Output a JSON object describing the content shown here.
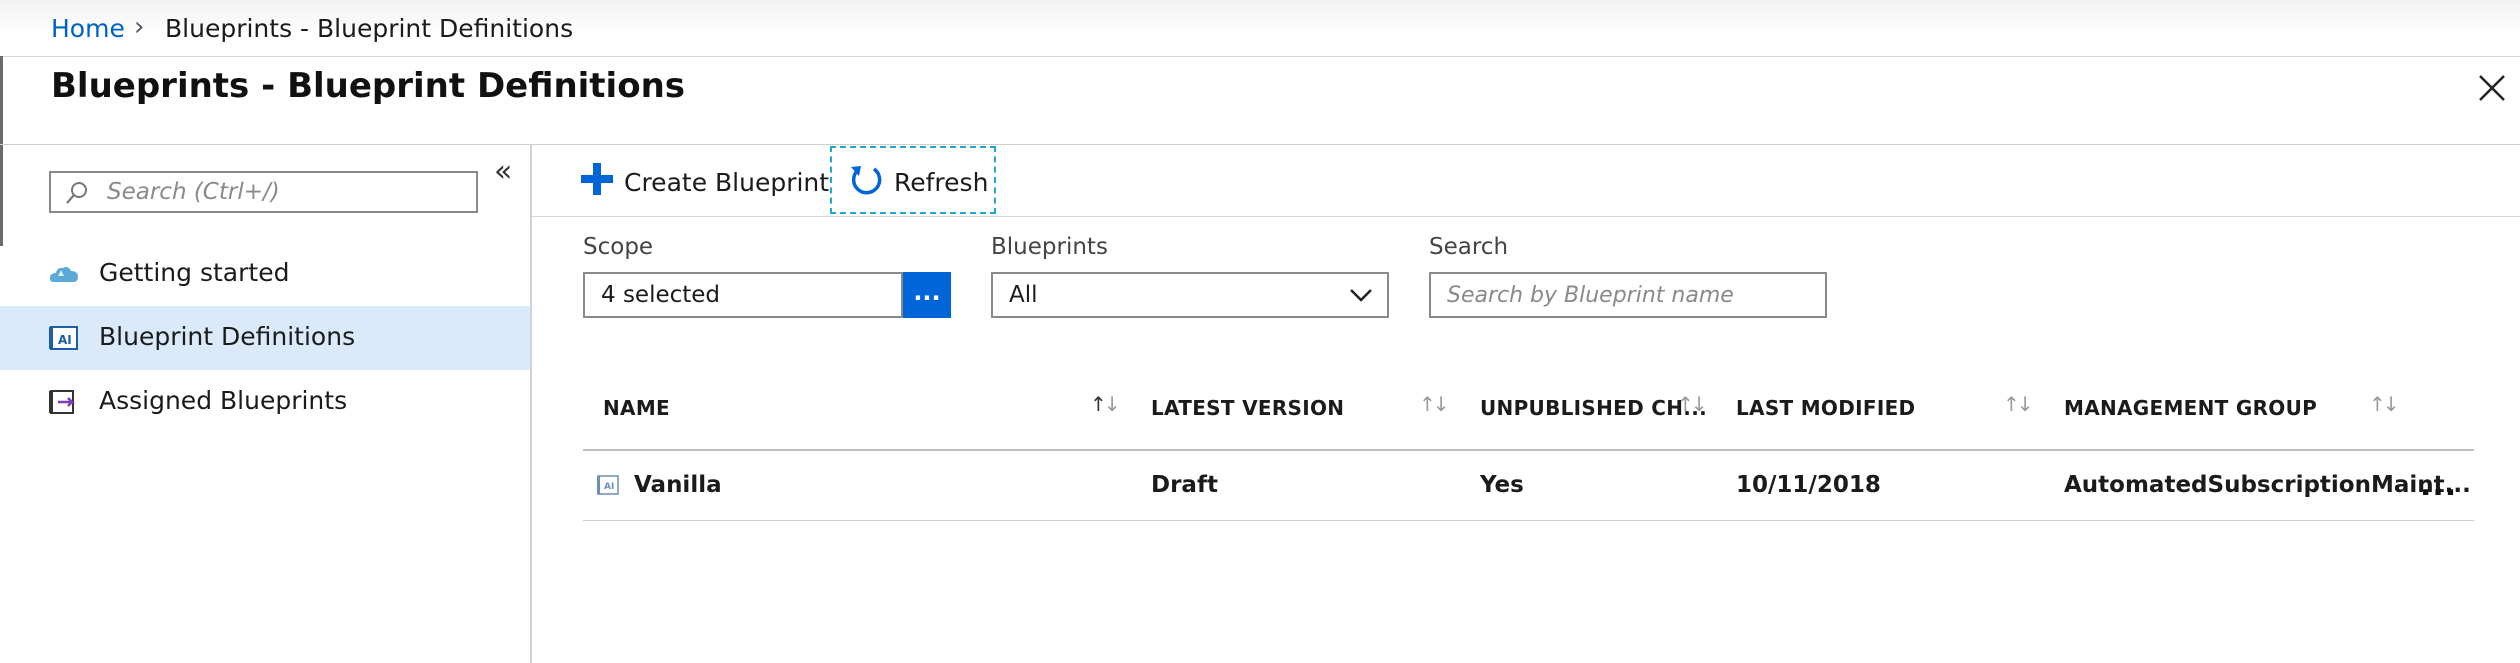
{
  "breadcrumb": {
    "home": "Home",
    "separator": ">",
    "current": "Blueprints - Blueprint Definitions"
  },
  "page": {
    "title": "Blueprints - Blueprint Definitions",
    "close_icon": "close-icon"
  },
  "sidebar": {
    "search_placeholder": "Search (Ctrl+/)",
    "collapse_glyph": "«",
    "items": [
      {
        "label": "Getting started",
        "icon": "cloud-icon",
        "selected": false
      },
      {
        "label": "Blueprint Definitions",
        "icon": "blueprint-definition-icon",
        "selected": true
      },
      {
        "label": "Assigned Blueprints",
        "icon": "assigned-blueprint-icon",
        "selected": false
      }
    ]
  },
  "toolbar": {
    "create_label": "Create Blueprint",
    "refresh_label": "Refresh"
  },
  "filters": {
    "scope_label": "Scope",
    "scope_value": "4 selected",
    "scope_button": "...",
    "blueprints_label": "Blueprints",
    "blueprints_value": "All",
    "search_label": "Search",
    "search_placeholder": "Search by Blueprint name"
  },
  "table": {
    "columns": [
      "NAME",
      "LATEST VERSION",
      "UNPUBLISHED CH...",
      "LAST MODIFIED",
      "MANAGEMENT GROUP"
    ],
    "rows": [
      {
        "name": "Vanilla",
        "latest_version": "Draft",
        "unpublished_changes": "Yes",
        "last_modified": "10/11/2018",
        "management_group": "AutomatedSubscriptionMaint..."
      }
    ],
    "row_menu": "..."
  },
  "colors": {
    "accent": "#0065d8",
    "link": "#0062c4",
    "selected_bg": "#dbeafb",
    "focus_border": "#1fa8d8"
  }
}
